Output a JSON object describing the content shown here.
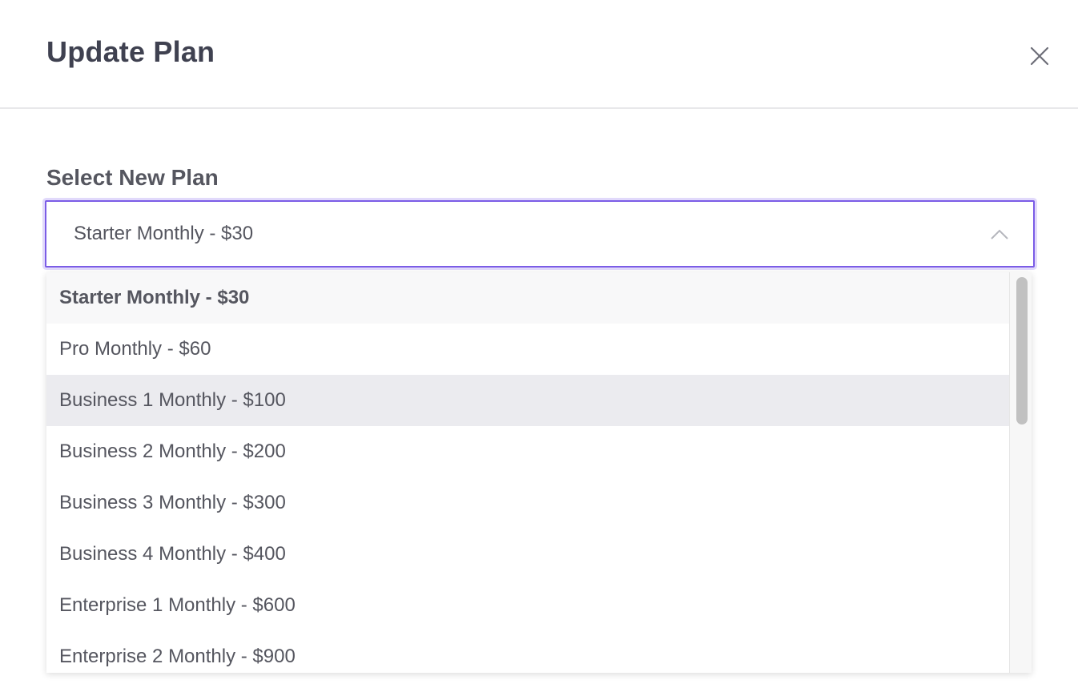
{
  "dialog": {
    "title": "Update Plan",
    "close_icon": "close-icon"
  },
  "form": {
    "label": "Select New Plan",
    "selected_value": "Starter Monthly - $30",
    "chevron_icon": "chevron-up-icon"
  },
  "dropdown": {
    "options": [
      {
        "label": "Starter Monthly - $30",
        "state": "selected"
      },
      {
        "label": "Pro Monthly - $60",
        "state": "normal"
      },
      {
        "label": "Business 1 Monthly - $100",
        "state": "hover"
      },
      {
        "label": "Business 2 Monthly - $200",
        "state": "normal"
      },
      {
        "label": "Business 3 Monthly - $300",
        "state": "normal"
      },
      {
        "label": "Business 4 Monthly - $400",
        "state": "normal"
      },
      {
        "label": "Enterprise 1 Monthly - $600",
        "state": "normal"
      },
      {
        "label": "Enterprise 2 Monthly - $900",
        "state": "normal"
      }
    ]
  },
  "colors": {
    "accent": "#7b5ce6",
    "title_text": "#3f4150",
    "body_text": "#55565f",
    "hover_bg": "#ebebef"
  }
}
